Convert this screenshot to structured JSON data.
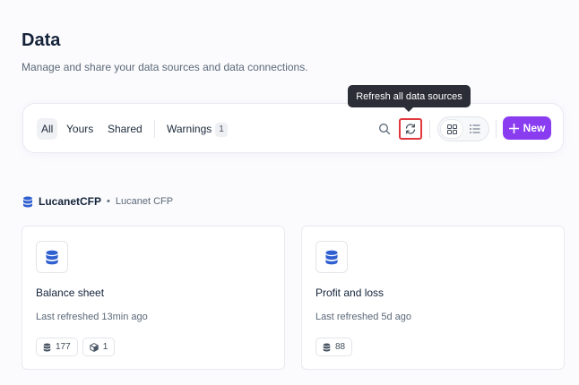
{
  "page": {
    "title": "Data",
    "subtitle": "Manage and share your data sources and data connections."
  },
  "toolbar": {
    "filters": [
      {
        "label": "All",
        "active": true
      },
      {
        "label": "Yours",
        "active": false
      },
      {
        "label": "Shared",
        "active": false
      }
    ],
    "warnings": {
      "label": "Warnings",
      "count": "1"
    },
    "tooltip": "Refresh all data sources",
    "new_label": "New",
    "icons": {
      "search": "search-icon",
      "refresh": "refresh-icon",
      "grid": "grid-view-icon",
      "list": "list-view-icon",
      "plus": "plus-icon"
    }
  },
  "colors": {
    "accent": "#8a3df0",
    "highlight": "#e0383e",
    "db_icon": "#2f5fd0"
  },
  "group": {
    "name": "LucanetCFP",
    "separator": "•",
    "subtitle": "Lucanet CFP"
  },
  "cards": [
    {
      "title": "Balance sheet",
      "meta": "Last refreshed 13min ago",
      "chips": [
        {
          "icon": "database-icon",
          "value": "177"
        },
        {
          "icon": "cube-icon",
          "value": "1"
        }
      ]
    },
    {
      "title": "Profit and loss",
      "meta": "Last refreshed 5d ago",
      "chips": [
        {
          "icon": "database-icon",
          "value": "88"
        }
      ]
    }
  ]
}
